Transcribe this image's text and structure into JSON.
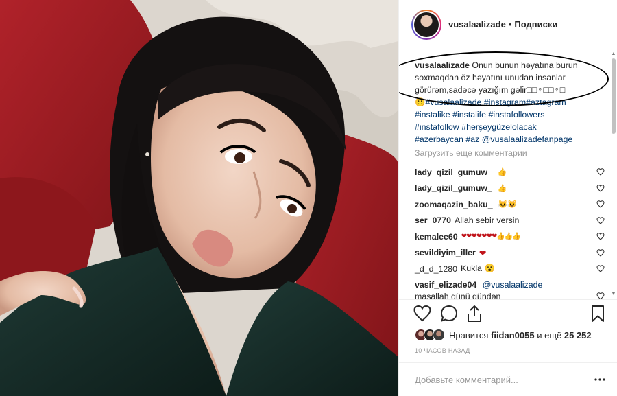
{
  "header": {
    "username": "vusalaalizade",
    "separator": "•",
    "follow_label": "Подписки"
  },
  "caption": {
    "username": "vusalaalizade",
    "text": "Onun bunun həyatına burun soxmaqdan öz həyatını unudan insanlar görürəm,sadəcə yazığım gəlir",
    "emoji": "🙂",
    "hashtags_line1": "#vusalaalizade #instagram#aztagram",
    "hashtags_line2": "#instalike #instalife #instafollowers",
    "hashtags_line3": "#instafollow #herşeygüzelolacak",
    "hashtags_line4": "#azerbaycan #az @vusalaalizadefanpage"
  },
  "load_more_label": "Загрузить еще комментарии",
  "comments": [
    {
      "user": "lady_qizil_gumuw_",
      "text": "👍"
    },
    {
      "user": "lady_qizil_gumuw_",
      "text": "👍"
    },
    {
      "user": "zoomaqazin_baku_",
      "text": "😺😺"
    },
    {
      "user": "ser_0770",
      "text": "Allah sebir versin"
    },
    {
      "user": "kemalee60",
      "text": "❤❤❤❤❤❤❤👍👍👍"
    },
    {
      "user": "sevildiyim_iller",
      "text": "❤"
    },
    {
      "user": "_d_d_1280",
      "text": "Kukla 😮"
    },
    {
      "user": "vasif_elizade04",
      "mention": "@vusalaalizade",
      "text2": "masallah günü gündən"
    }
  ],
  "likes": {
    "prefix": "Нравится",
    "user": "fiidan0055",
    "middle": "и ещё",
    "count": "25 252"
  },
  "timestamp": "10 ЧАСОВ НАЗАД",
  "comment_input": {
    "placeholder": "Добавьте комментарий..."
  },
  "colors": {
    "link": "#003569",
    "muted": "#999999",
    "heart_red": "#c0141b",
    "photo_sofa": "#9e1a1e"
  },
  "icons": [
    "heart-icon",
    "comment-icon",
    "share-icon",
    "bookmark-icon",
    "more-icon"
  ]
}
